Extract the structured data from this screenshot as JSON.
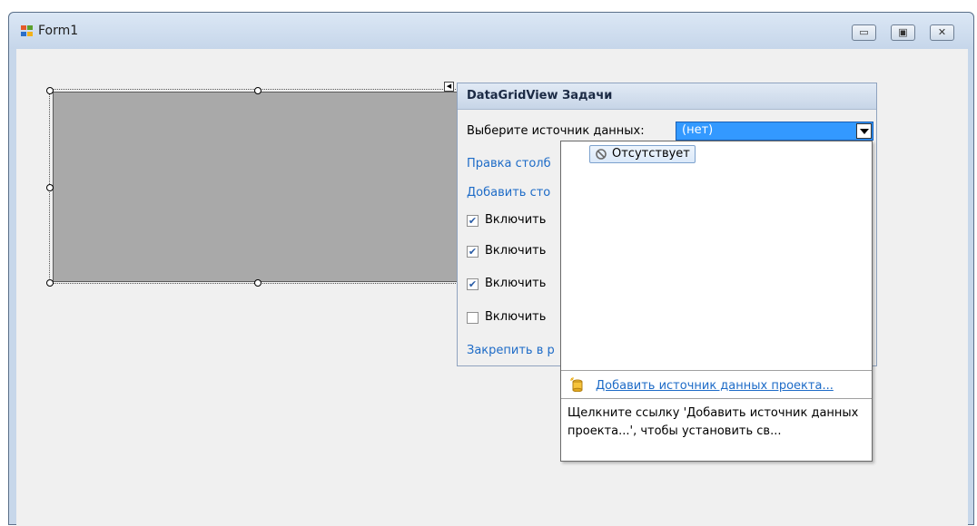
{
  "window": {
    "title": "Form1",
    "buttons": {
      "minimize": "▭",
      "maximize": "▣",
      "close": "✕"
    }
  },
  "smart_tag": {
    "title": "DataGridView Задачи",
    "data_source_label": "Выберите источник данных:",
    "data_source_value": "(нет)",
    "edit_columns_link": "Правка столб",
    "add_column_link": "Добавить сто",
    "checkboxes": [
      {
        "label": "Включить",
        "checked": true
      },
      {
        "label": "Включить",
        "checked": true
      },
      {
        "label": "Включить",
        "checked": true
      },
      {
        "label": "Включить",
        "checked": false
      }
    ],
    "dock_link": "Закрепить в р"
  },
  "dropdown": {
    "none_item": "Отсутствует",
    "add_source_link": "Добавить источник данных проекта...",
    "hint": "Щелкните ссылку 'Добавить источник данных проекта...', чтобы установить св..."
  },
  "colors": {
    "grid_background": "#a9a9a9",
    "selected_combo": "#3399ff",
    "link": "#1d6bc7"
  }
}
